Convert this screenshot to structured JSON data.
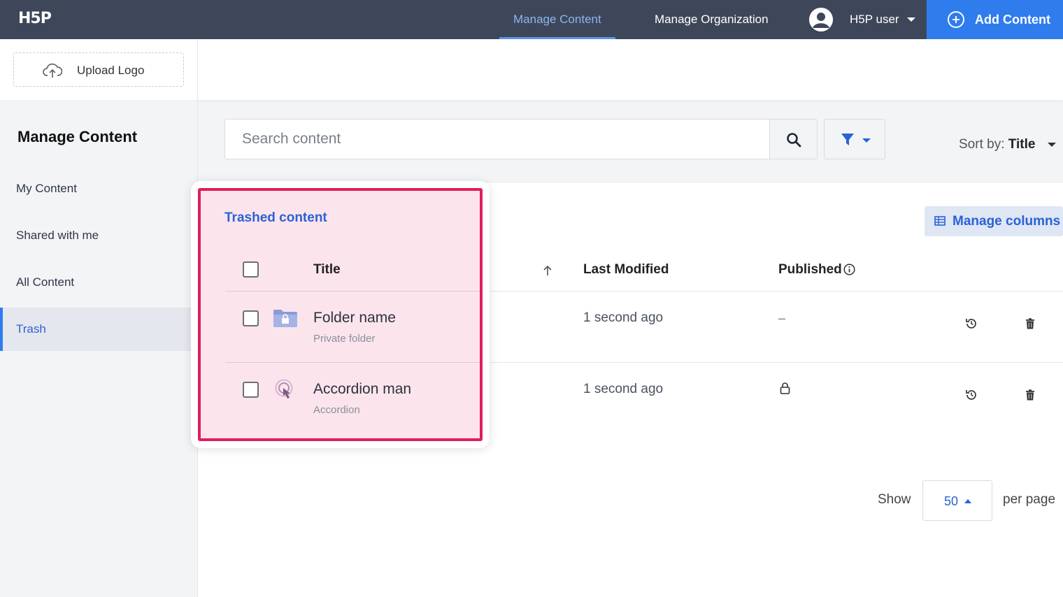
{
  "app": {
    "logo": "H5P"
  },
  "topnav": {
    "tabs": [
      {
        "label": "Manage Content",
        "active": true
      },
      {
        "label": "Manage Organization",
        "active": false
      }
    ],
    "user_name": "H5P user",
    "add_button": "Add Content"
  },
  "upload": {
    "label": "Upload Logo"
  },
  "sidebar": {
    "title": "Manage Content",
    "items": [
      {
        "label": "My Content"
      },
      {
        "label": "Shared with me"
      },
      {
        "label": "All Content"
      },
      {
        "label": "Trash",
        "active": true
      }
    ]
  },
  "search": {
    "placeholder": "Search content"
  },
  "sort": {
    "prefix": "Sort by:",
    "value": "Title"
  },
  "table": {
    "manage_columns": "Manage columns",
    "headers": {
      "title": "Title",
      "last_modified": "Last Modified",
      "published": "Published"
    },
    "rows": [
      {
        "title": "Folder name",
        "subtitle": "Private folder",
        "last_modified": "1 second ago",
        "published": "–",
        "icon": "locked-folder-icon"
      },
      {
        "title": "Accordion man",
        "subtitle": "Accordion",
        "last_modified": "1 second ago",
        "published": "lock-icon",
        "icon": "accordion-icon"
      }
    ]
  },
  "popup": {
    "heading": "Trashed content"
  },
  "pagination": {
    "show_label": "Show",
    "per_page_value": "50",
    "per_page_label": "per page"
  },
  "colors": {
    "topbar": "#3d4759",
    "accent": "#2f7ced",
    "highlight_border": "#e01e5a",
    "highlight_fill": "#fce4ec"
  }
}
